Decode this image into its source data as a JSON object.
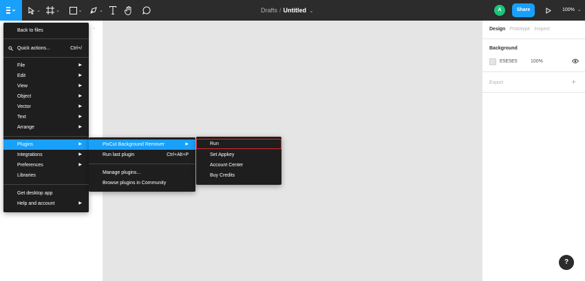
{
  "toolbar": {
    "breadcrumb_parent": "Drafts",
    "breadcrumb_sep": "/",
    "file_name": "Untitled",
    "avatar_initial": "A",
    "share_label": "Share",
    "zoom_level": "100%"
  },
  "left_panel": {
    "hint": "⌄"
  },
  "main_menu": {
    "items": [
      {
        "label": "Back to files"
      },
      {
        "label": "Quick actions...",
        "shortcut": "Ctrl+/"
      },
      {
        "label": "File"
      },
      {
        "label": "Edit"
      },
      {
        "label": "View"
      },
      {
        "label": "Object"
      },
      {
        "label": "Vector"
      },
      {
        "label": "Text"
      },
      {
        "label": "Arrange"
      },
      {
        "label": "Plugins"
      },
      {
        "label": "Integrations"
      },
      {
        "label": "Preferences"
      },
      {
        "label": "Libraries"
      },
      {
        "label": "Get desktop app"
      },
      {
        "label": "Help and account"
      }
    ]
  },
  "plugins_menu": {
    "items": [
      {
        "label": "PixCut Background Remover"
      },
      {
        "label": "Run last plugin",
        "shortcut": "Ctrl+Alt+P"
      },
      {
        "label": "Manage plugins..."
      },
      {
        "label": "Browse plugins in Community"
      }
    ]
  },
  "pixcut_menu": {
    "items": [
      {
        "label": "Run"
      },
      {
        "label": "Set Appkey"
      },
      {
        "label": "Account Center"
      },
      {
        "label": "Buy Credits"
      }
    ]
  },
  "right_panel": {
    "tabs": [
      "Design",
      "Prototype",
      "Inspect"
    ],
    "background_label": "Background",
    "bg_hex": "E5E5E5",
    "bg_opacity": "100%",
    "export_label": "Export",
    "plus": "+"
  },
  "help": "?",
  "colors": {
    "accent": "#18a0fb",
    "avatar": "#1bc47d",
    "highlight_outline": "#e0282e"
  }
}
